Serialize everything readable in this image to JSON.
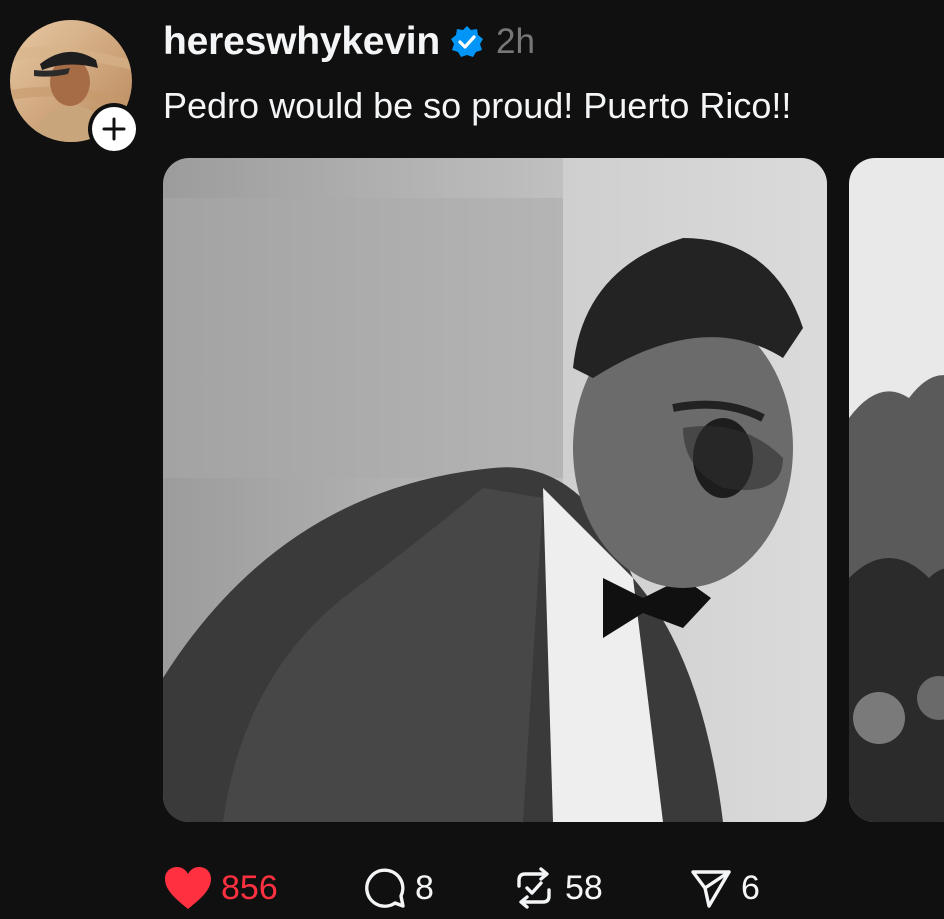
{
  "post": {
    "username": "hereswhykevin",
    "verified_icon": "verified-badge-icon",
    "time": "2h",
    "caption": "Pedro would be so proud! Puerto Rico!!",
    "follow_icon": "plus-icon"
  },
  "media": {
    "images": [
      {
        "icon": "photo-man-speaking",
        "tone": "black-and-white"
      },
      {
        "icon": "photo-crowd",
        "tone": "black-and-white"
      }
    ]
  },
  "actions": {
    "like_count": "856",
    "reply_count": "8",
    "repost_count": "58",
    "share_count": "6"
  },
  "colors": {
    "background": "#101010",
    "text": "#f3f5f7",
    "muted": "#777777",
    "like": "#ff3040",
    "verified": "#0095f6"
  }
}
